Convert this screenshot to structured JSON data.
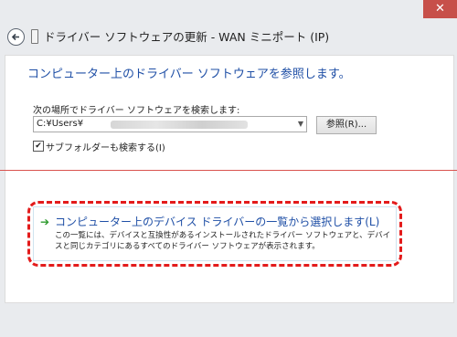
{
  "window": {
    "title": "ドライバー ソフトウェアの更新 - WAN ミニポート (IP)",
    "close_glyph": "✕"
  },
  "main": {
    "heading": "コンピューター上のドライバー ソフトウェアを参照します。",
    "search_label": "次の場所でドライバー ソフトウェアを検索します:",
    "path_value": "C:¥Users¥",
    "browse_label": "参照(R)...",
    "include_subfolders_label": "サブフォルダーも検索する(I)",
    "include_subfolders_checked": true
  },
  "option": {
    "title": "コンピューター上のデバイス ドライバーの一覧から選択します(L)",
    "description": "この一覧には、デバイスと互換性があるインストールされたドライバー ソフトウェアと、デバイスと同じカテゴリにあるすべてのドライバー ソフトウェアが表示されます。"
  },
  "colors": {
    "heading": "#1f4fa6",
    "highlight_dashed_border": "#e31b1b",
    "separator": "#d9534f",
    "arrow": "#2e9a2e"
  },
  "icons": [
    "back-arrow-icon",
    "device-icon",
    "green-arrow-icon",
    "chevron-down-icon",
    "close-icon"
  ]
}
